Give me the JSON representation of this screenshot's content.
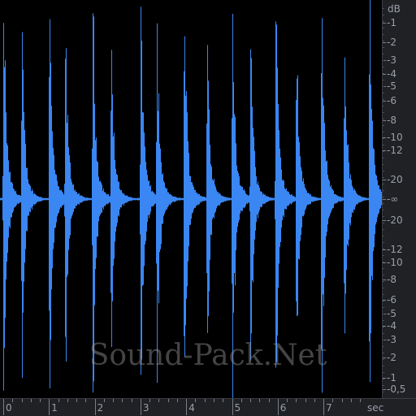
{
  "colors": {
    "background": "#000000",
    "waveform": "#3a86f2",
    "ruler_bg": "#1f2125",
    "ruler_text": "#9a9ea7"
  },
  "db_ruler": {
    "unit_label": "dB",
    "labels": [
      "-1",
      "-2",
      "-3",
      "-4",
      "-5",
      "-6",
      "-8",
      "-10",
      "-12",
      "-20",
      "-∞",
      "-20",
      "-12",
      "-10",
      "-8",
      "-6",
      "-5",
      "-4",
      "-3",
      "-2",
      "-1",
      "-0,5"
    ]
  },
  "time_ruler": {
    "labels": [
      "0",
      "1",
      "2",
      "3",
      "4",
      "5",
      "6",
      "7"
    ],
    "unit_label": "sec"
  },
  "watermark": "Sound-Pack.Net",
  "chart_data": {
    "type": "area",
    "transient_times_sec": [
      0.0,
      0.4,
      1.0,
      1.35,
      1.95,
      2.35,
      3.0,
      3.35,
      3.95,
      4.45,
      5.0,
      5.4,
      5.95,
      6.4,
      6.95,
      7.45,
      8.0
    ],
    "x_range_sec": [
      0,
      8.1
    ],
    "ylabel": "dB"
  }
}
